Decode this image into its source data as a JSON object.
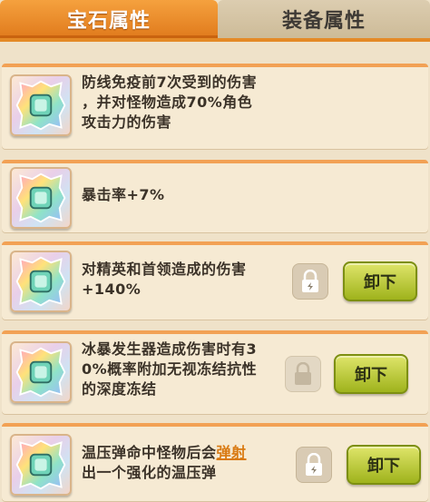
{
  "tabs": [
    {
      "label": "宝石属性",
      "active": true
    },
    {
      "label": "装备属性",
      "active": false
    }
  ],
  "gems": [
    {
      "lines": [
        "防线免疫前7次受到的伤害",
        "，并对怪物造成70%角色",
        "攻击力的伤害"
      ]
    },
    {
      "lines": [
        "暴击率+7%"
      ]
    },
    {
      "lines": [
        "对精英和首领造成的伤害",
        "+140%"
      ],
      "button": "卸下"
    },
    {
      "lines": [
        "冰暴发生器造成伤害时有3",
        "0%概率附加无视冻结抗性",
        "的深度冻结"
      ],
      "button": "卸下"
    },
    {
      "line1_pre": "温压弹命中怪物后会",
      "line1_highlight": "弹射",
      "line2": "出一个强化的温压弹",
      "button": "卸下"
    }
  ],
  "colors": {
    "tab_active": "#e88a25",
    "card_border": "#f2a154",
    "button_green": "#b7c82c",
    "highlight": "#d97a12"
  },
  "icons": {
    "gem": "rainbow-gem-icon",
    "lock": "lock-icon"
  }
}
